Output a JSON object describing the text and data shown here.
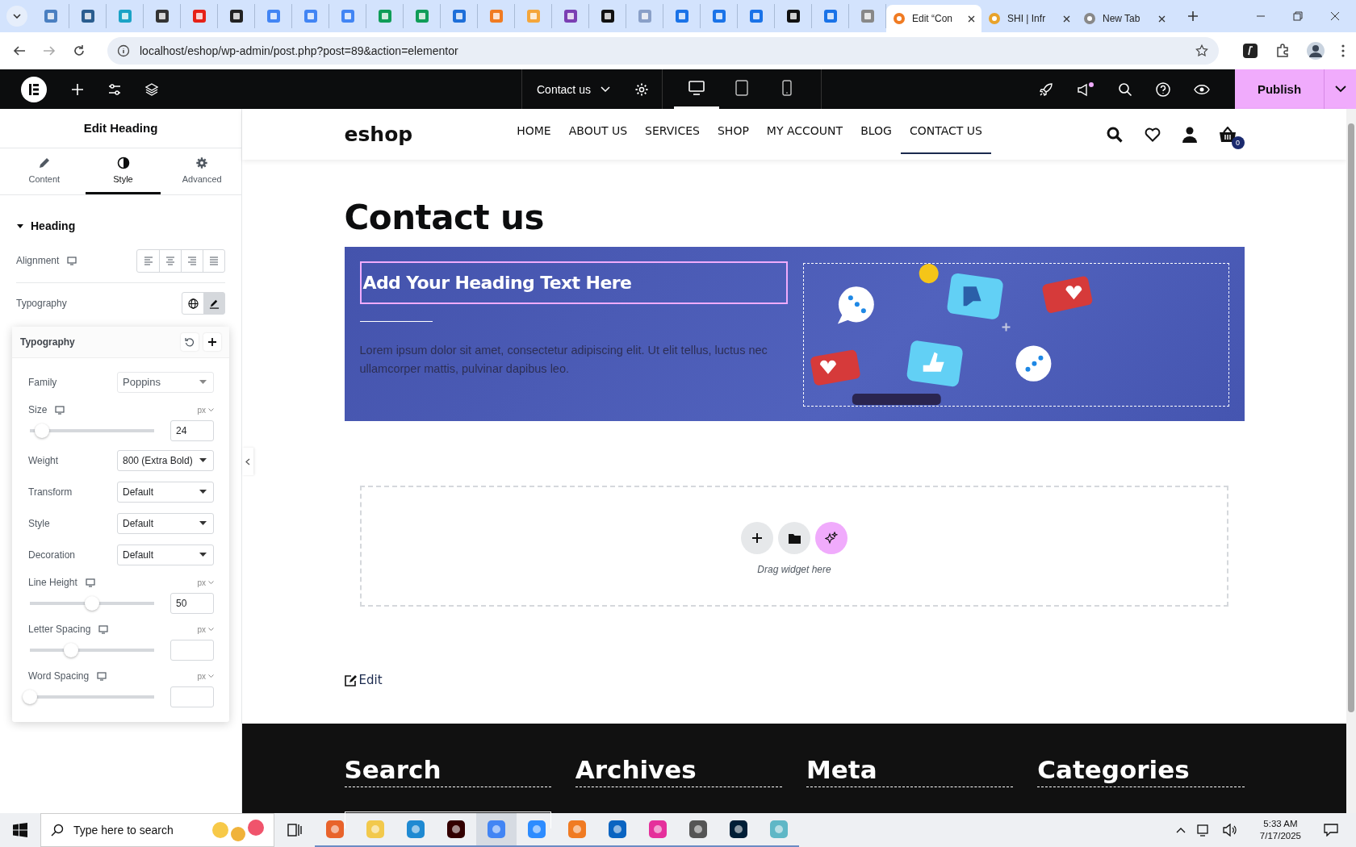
{
  "browser": {
    "tabs": [
      {
        "title": "Edit “Con",
        "selected": true
      },
      {
        "title": "SHI | Infr",
        "selected": false
      },
      {
        "title": "New Tab",
        "selected": false
      }
    ],
    "url": "localhost/eshop/wp-admin/post.php?post=89&action=elementor"
  },
  "editor_bar": {
    "page": "Contact us",
    "publish": "Publish",
    "devices": [
      {
        "kind": "desktop",
        "selected": true
      },
      {
        "kind": "tablet",
        "selected": false
      },
      {
        "kind": "mobile",
        "selected": false
      }
    ]
  },
  "panel": {
    "title": "Edit Heading",
    "tabs": [
      {
        "kind": "content",
        "label": "Content",
        "selected": false
      },
      {
        "kind": "style",
        "label": "Style",
        "selected": true
      },
      {
        "kind": "advanced",
        "label": "Advanced",
        "selected": false
      }
    ],
    "section": {
      "title": "Heading",
      "expanded": true
    },
    "alignment": {
      "label": "Alignment",
      "options": [
        {
          "kind": "left",
          "selected": false
        },
        {
          "kind": "center",
          "selected": false
        },
        {
          "kind": "right",
          "selected": false
        },
        {
          "kind": "justify",
          "selected": false
        }
      ]
    },
    "typography": {
      "label": "Typography",
      "editing": true
    },
    "popover": {
      "title": "Typography",
      "controls": [
        {
          "kind": "select",
          "label": "Family",
          "value": "Poppins"
        },
        {
          "kind": "slider",
          "label": "Size",
          "unit": "px",
          "level": 0.1,
          "value": "24"
        },
        {
          "kind": "select",
          "label": "Weight",
          "value": "800 (Extra Bold)"
        },
        {
          "kind": "select",
          "label": "Transform",
          "value": "Default"
        },
        {
          "kind": "select",
          "label": "Style",
          "value": "Default"
        },
        {
          "kind": "select",
          "label": "Decoration",
          "value": "Default"
        },
        {
          "kind": "slider",
          "label": "Line Height",
          "unit": "px",
          "level": 0.5,
          "value": "50"
        },
        {
          "kind": "slider",
          "label": "Letter Spacing",
          "unit": "px",
          "level": 0.33
        },
        {
          "kind": "slider",
          "label": "Word Spacing",
          "unit": "px",
          "level": 0
        }
      ]
    }
  },
  "site": {
    "logo": "eshop",
    "menu": [
      {
        "label": "HOME",
        "selected": false
      },
      {
        "label": "ABOUT US",
        "selected": false
      },
      {
        "label": "SERVICES",
        "selected": false
      },
      {
        "label": "SHOP",
        "selected": false
      },
      {
        "label": "MY ACCOUNT",
        "selected": false
      },
      {
        "label": "BLOG",
        "selected": false
      },
      {
        "label": "CONTACT US",
        "selected": true
      }
    ],
    "cart_count": "0",
    "page_title": "Contact us",
    "banner": {
      "heading": "Add Your Heading Text Here",
      "text": "Lorem ipsum dolor sit amet, consectetur adipiscing elit. Ut elit tellus, luctus nec ullamcorper mattis, pulvinar dapibus leo."
    },
    "drop_zone": {
      "hint": "Drag widget here"
    },
    "edit_link": "Edit",
    "footer": [
      {
        "title": "Search"
      },
      {
        "title": "Archives"
      },
      {
        "title": "Meta"
      },
      {
        "title": "Categories"
      }
    ]
  },
  "taskbar": {
    "search_placeholder": "Type here to search",
    "time": "5:33 AM",
    "date": "7/17/2025"
  }
}
